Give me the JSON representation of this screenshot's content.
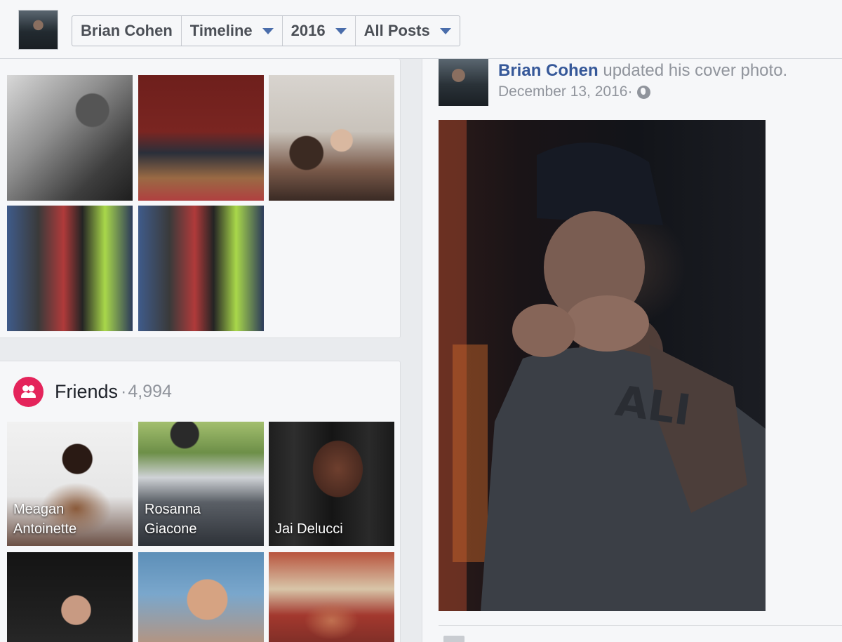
{
  "header": {
    "scrubber": {
      "name": "Brian Cohen",
      "section": "Timeline",
      "year": "2016",
      "filter": "All Posts"
    }
  },
  "friends": {
    "title": "Friends",
    "separator": "·",
    "count": "4,994",
    "tiles": [
      {
        "line1": "Meagan",
        "line2": "Antoinette"
      },
      {
        "line1": "Rosanna",
        "line2": "Giacone"
      },
      {
        "line1": "Jai Delucci",
        "line2": ""
      }
    ]
  },
  "post": {
    "author": "Brian Cohen",
    "action": " updated his cover photo.",
    "date": "December 13, 2016",
    "separator": " ·"
  },
  "icons": {
    "caret": "chevron-down-icon",
    "friends": "friends-icon",
    "privacy": "globe-icon"
  },
  "colors": {
    "link": "#365899",
    "muted": "#90949c",
    "friends_accent": "#e4245b",
    "caret": "#4a6dab"
  }
}
